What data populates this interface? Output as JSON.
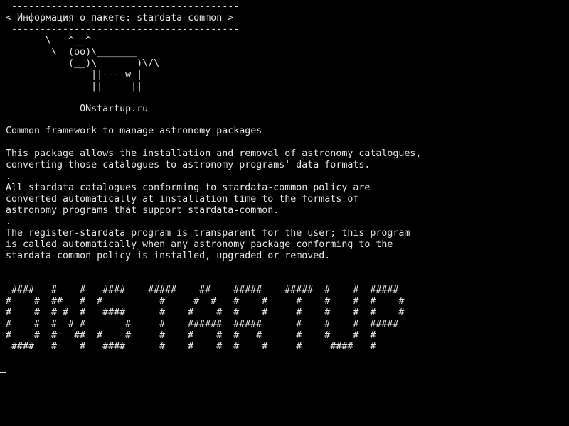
{
  "window": {
    "title": "",
    "background_color": "#000000",
    "text_color": "#e6e6e6"
  },
  "terminal": {
    "banner": [
      " ----------------------------------------",
      "< Информация о пакете: stardata-common >",
      " ----------------------------------------",
      "       \\   ^__^",
      "        \\  (oo)\\_______",
      "           (__)\\       )\\/\\",
      "               ||----w |",
      "               ||     ||",
      "",
      "             ONstartup.ru"
    ],
    "description": [
      "Common framework to manage astronomy packages",
      "",
      "This package allows the installation and removal of astronomy catalogues,",
      "converting those catalogues to astronomy programs' data formats.",
      ".",
      "All stardata catalogues conforming to stardata-common policy are",
      "converted automatically at installation time to the formats of",
      "astronomy programs that support stardata-common.",
      ".",
      "The register-stardata program is transparent for the user; this program",
      "is called automatically when any astronomy package conforming to the",
      "stardata-common policy is installed, upgraded or removed."
    ],
    "big_text": [
      " ####   #    #   ####    #####    ##    #####    #####  #    #  #####",
      "#    #  ##   #  #          #     #  #   #    #     #    #    #  #    #",
      "#    #  # #  #   ####      #    #    #  #    #     #    #    #  #    #",
      "#    #  #  # #       #     #    ######  #####      #    #    #  #####",
      "#    #  #   ##  #    #     #    #    #  #   #      #    #    #  #",
      " ####   #    #   ####      #    #    #  #    #     #     ####   #"
    ],
    "cursor": "cursor"
  }
}
